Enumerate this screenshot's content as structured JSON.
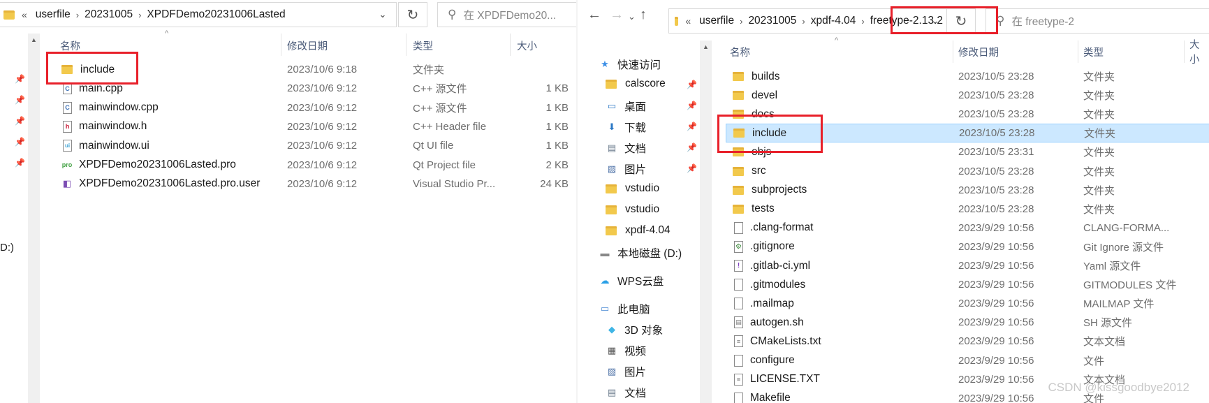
{
  "left": {
    "address": {
      "overflow": "«",
      "crumbs": [
        "userfile",
        "20231005",
        "XPDFDemo20231006Lasted"
      ],
      "separator": "›",
      "dropdown": "⌄",
      "refresh": "↻",
      "search_placeholder": "在 XPDFDemo20..."
    },
    "columns": {
      "name": "名称",
      "date": "修改日期",
      "type": "类型",
      "size": "大小"
    },
    "files": [
      {
        "name": "include",
        "date": "2023/10/6 9:18",
        "type": "文件夹",
        "size": "",
        "icon": "folder-icon"
      },
      {
        "name": "main.cpp",
        "date": "2023/10/6 9:12",
        "type": "C++ 源文件",
        "size": "1 KB",
        "icon": "cpp-file-icon"
      },
      {
        "name": "mainwindow.cpp",
        "date": "2023/10/6 9:12",
        "type": "C++ 源文件",
        "size": "1 KB",
        "icon": "cpp-file-icon"
      },
      {
        "name": "mainwindow.h",
        "date": "2023/10/6 9:12",
        "type": "C++ Header file",
        "size": "1 KB",
        "icon": "header-file-icon"
      },
      {
        "name": "mainwindow.ui",
        "date": "2023/10/6 9:12",
        "type": "Qt UI file",
        "size": "1 KB",
        "icon": "ui-file-icon"
      },
      {
        "name": "XPDFDemo20231006Lasted.pro",
        "date": "2023/10/6 9:12",
        "type": "Qt Project file",
        "size": "2 KB",
        "icon": "pro-file-icon"
      },
      {
        "name": "XPDFDemo20231006Lasted.pro.user",
        "date": "2023/10/6 9:12",
        "type": "Visual Studio Pr...",
        "size": "24 KB",
        "icon": "vs-user-file-icon"
      }
    ],
    "drive_fragment": "D:)"
  },
  "right": {
    "address": {
      "overflow": "«",
      "crumbs": [
        "userfile",
        "20231005",
        "xpdf-4.04",
        "freetype-2.13.2"
      ],
      "separator": "›",
      "dropdown": "⌄",
      "refresh": "↻",
      "search_placeholder": "在 freetype-2"
    },
    "nav_buttons": {
      "back": "←",
      "forward": "→",
      "recent": "⌄",
      "up": "↑"
    },
    "columns": {
      "name": "名称",
      "date": "修改日期",
      "type": "类型",
      "size": "大小"
    },
    "sidebar": [
      {
        "label": "快速访问",
        "icon": "star-icon",
        "pinned": false
      },
      {
        "label": "calscore",
        "icon": "folder-icon",
        "pinned": true
      },
      {
        "label": "桌面",
        "icon": "desktop-icon",
        "pinned": true
      },
      {
        "label": "下载",
        "icon": "download-icon",
        "pinned": true
      },
      {
        "label": "文档",
        "icon": "documents-icon",
        "pinned": true
      },
      {
        "label": "图片",
        "icon": "pictures-icon",
        "pinned": true
      },
      {
        "label": "vstudio",
        "icon": "folder-icon",
        "pinned": false
      },
      {
        "label": "vstudio",
        "icon": "folder-icon",
        "pinned": false
      },
      {
        "label": "xpdf-4.04",
        "icon": "folder-icon",
        "pinned": false
      },
      {
        "label": "本地磁盘 (D:)",
        "icon": "drive-icon",
        "pinned": false
      },
      {
        "label": "WPS云盘",
        "icon": "cloud-icon",
        "pinned": false
      },
      {
        "label": "此电脑",
        "icon": "computer-icon",
        "pinned": false
      },
      {
        "label": "3D 对象",
        "icon": "3d-objects-icon",
        "pinned": false
      },
      {
        "label": "视频",
        "icon": "videos-icon",
        "pinned": false
      },
      {
        "label": "图片",
        "icon": "pictures-icon",
        "pinned": false
      },
      {
        "label": "文档",
        "icon": "documents-icon",
        "pinned": false
      }
    ],
    "files": [
      {
        "name": "builds",
        "date": "2023/10/5 23:28",
        "type": "文件夹",
        "icon": "folder-icon"
      },
      {
        "name": "devel",
        "date": "2023/10/5 23:28",
        "type": "文件夹",
        "icon": "folder-icon"
      },
      {
        "name": "docs",
        "date": "2023/10/5 23:28",
        "type": "文件夹",
        "icon": "folder-icon"
      },
      {
        "name": "include",
        "date": "2023/10/5 23:28",
        "type": "文件夹",
        "icon": "folder-icon",
        "selected": true
      },
      {
        "name": "objs",
        "date": "2023/10/5 23:31",
        "type": "文件夹",
        "icon": "folder-icon"
      },
      {
        "name": "src",
        "date": "2023/10/5 23:28",
        "type": "文件夹",
        "icon": "folder-icon"
      },
      {
        "name": "subprojects",
        "date": "2023/10/5 23:28",
        "type": "文件夹",
        "icon": "folder-icon"
      },
      {
        "name": "tests",
        "date": "2023/10/5 23:28",
        "type": "文件夹",
        "icon": "folder-icon"
      },
      {
        "name": ".clang-format",
        "date": "2023/9/29 10:56",
        "type": "CLANG-FORMA...",
        "icon": "file-icon"
      },
      {
        "name": ".gitignore",
        "date": "2023/9/29 10:56",
        "type": "Git Ignore 源文件",
        "icon": "gitignore-file-icon"
      },
      {
        "name": ".gitlab-ci.yml",
        "date": "2023/9/29 10:56",
        "type": "Yaml 源文件",
        "icon": "yaml-file-icon"
      },
      {
        "name": ".gitmodules",
        "date": "2023/9/29 10:56",
        "type": "GITMODULES 文件",
        "icon": "file-icon"
      },
      {
        "name": ".mailmap",
        "date": "2023/9/29 10:56",
        "type": "MAILMAP 文件",
        "icon": "file-icon"
      },
      {
        "name": "autogen.sh",
        "date": "2023/9/29 10:56",
        "type": "SH 源文件",
        "icon": "script-file-icon"
      },
      {
        "name": "CMakeLists.txt",
        "date": "2023/9/29 10:56",
        "type": "文本文档",
        "icon": "text-file-icon"
      },
      {
        "name": "configure",
        "date": "2023/9/29 10:56",
        "type": "文件",
        "icon": "file-icon"
      },
      {
        "name": "LICENSE.TXT",
        "date": "2023/9/29 10:56",
        "type": "文本文档",
        "icon": "text-file-icon"
      },
      {
        "name": "Makefile",
        "date": "2023/9/29 10:56",
        "type": "文件",
        "icon": "file-icon"
      }
    ]
  },
  "watermark": "CSDN @kissgoodbye2012",
  "highlight_color": "#e8202a",
  "selection_color": "#cce8ff"
}
